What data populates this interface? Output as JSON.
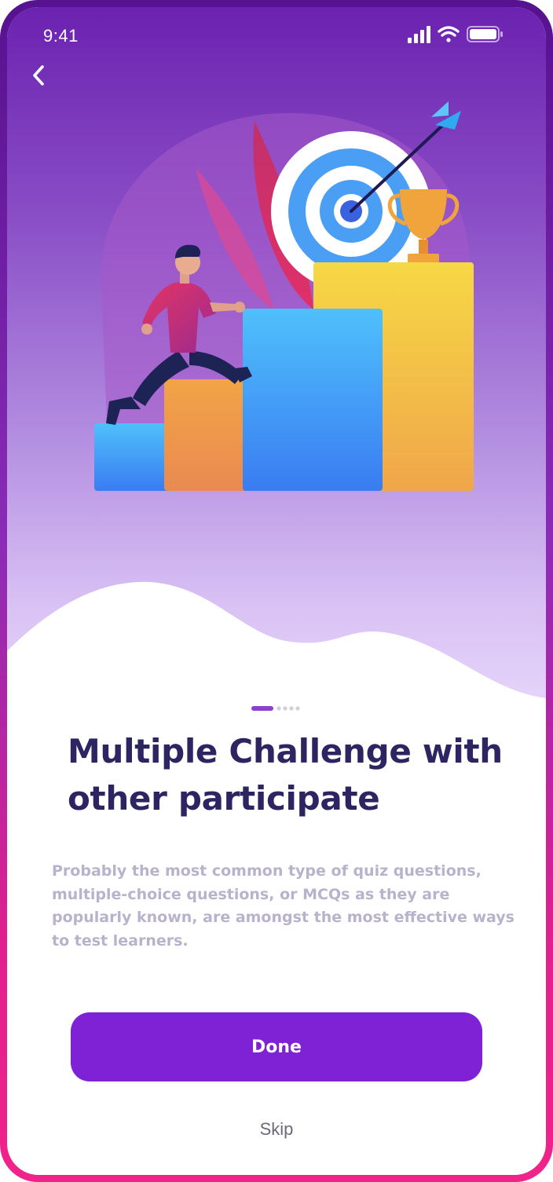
{
  "status_bar": {
    "time": "9:41",
    "signal_icon": "cellular-signal-icon",
    "wifi_icon": "wifi-icon",
    "battery_icon": "battery-icon"
  },
  "nav": {
    "back_icon": "chevron-left-icon"
  },
  "illustration": {
    "name": "person-climbing-steps-to-target-and-trophy"
  },
  "pager": {
    "total": 5,
    "active_index": 0
  },
  "content": {
    "title": "Multiple Challenge with other participate",
    "description": "Probably the most common type of quiz questions, multiple-choice questions, or MCQs as they are popularly known, are amongst the most effective ways to test learners."
  },
  "actions": {
    "done_label": "Done",
    "skip_label": "Skip"
  },
  "colors": {
    "accent": "#7f22d6",
    "title": "#2d2561",
    "description": "#b9b2cc",
    "hero_top": "#6b22b0",
    "frame_bottom": "#f0238a"
  }
}
